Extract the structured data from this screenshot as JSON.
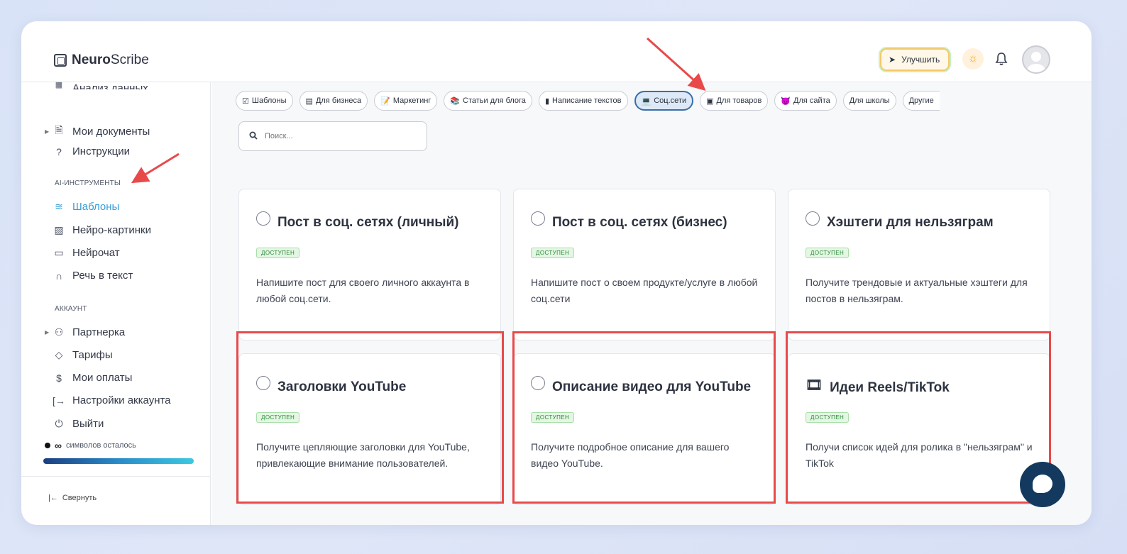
{
  "app": {
    "logo_bold": "Neuro",
    "logo_rest": "Scribe"
  },
  "header": {
    "upgrade_label": "Улучшить"
  },
  "sidebar": {
    "cut_item": "Анализ данных",
    "items_top": [
      {
        "label": "Мои документы",
        "icon": "document-icon"
      },
      {
        "label": "Инструкции",
        "icon": "help-icon"
      }
    ],
    "section_ai": "AI-ИНСТРУМЕНТЫ",
    "items_ai": [
      {
        "label": "Шаблоны",
        "icon": "layers-icon"
      },
      {
        "label": "Нейро-картинки",
        "icon": "image-icon"
      },
      {
        "label": "Нейрочат",
        "icon": "chat-icon"
      },
      {
        "label": "Речь в текст",
        "icon": "headphones-icon"
      }
    ],
    "section_account": "АККАУНТ",
    "items_account": [
      {
        "label": "Партнерка",
        "icon": "users-icon"
      },
      {
        "label": "Тарифы",
        "icon": "tag-icon"
      },
      {
        "label": "Мои оплаты",
        "icon": "dollar-icon"
      },
      {
        "label": "Настройки аккаунта",
        "icon": "login-icon"
      },
      {
        "label": "Выйти",
        "icon": "power-icon"
      }
    ],
    "quota_symbol": "∞",
    "quota_text": "символов осталось",
    "collapse_label": "Свернуть"
  },
  "chips": [
    {
      "label": "Шаблоны",
      "icon": "☑"
    },
    {
      "label": "Для бизнеса",
      "icon": "▤"
    },
    {
      "label": "Маркетинг",
      "icon": "📝"
    },
    {
      "label": "Статьи для блога",
      "icon": "📚"
    },
    {
      "label": "Написание текстов",
      "icon": "▮"
    },
    {
      "label": "Соц.сети",
      "icon": "💻"
    },
    {
      "label": "Для товаров",
      "icon": "▣"
    },
    {
      "label": "Для сайта",
      "icon": "😈"
    },
    {
      "label": "Для школы",
      "icon": ""
    },
    {
      "label": "Другие",
      "icon": ""
    }
  ],
  "search": {
    "placeholder": "Поиск..."
  },
  "cards": [
    {
      "title": "Пост в соц. сетях (личный)",
      "badge": "ДОСТУПЕН",
      "desc": "Напишите пост для своего личного аккаунта в любой соц.сети."
    },
    {
      "title": "Пост в соц. сетях (бизнес)",
      "badge": "ДОСТУПЕН",
      "desc": "Напишите пост о своем продукте/услуге в любой соц.сети"
    },
    {
      "title": "Хэштеги для нельзяграм",
      "badge": "ДОСТУПЕН",
      "desc": "Получите трендовые и актуальные хэштеги для постов в нельзяграм."
    },
    {
      "title": "Заголовки YouTube",
      "badge": "ДОСТУПЕН",
      "desc": "Получите цепляющие заголовки для YouTube, привлекающие внимание пользователей."
    },
    {
      "title": "Описание видео для YouTube",
      "badge": "ДОСТУПЕН",
      "desc": "Получите подробное описание для вашего видео YouTube."
    },
    {
      "title": "Идеи Reels/TikTok",
      "badge": "ДОСТУПЕН",
      "desc": "Получи список идей для ролика в \"нельзяграм\" и TikTok"
    }
  ]
}
